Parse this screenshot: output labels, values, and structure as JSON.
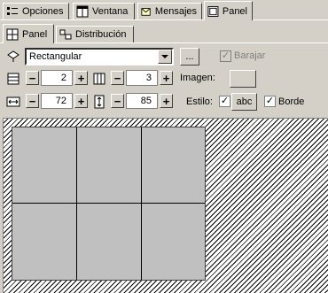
{
  "tabs": [
    {
      "label": "Opciones"
    },
    {
      "label": "Ventana"
    },
    {
      "label": "Mensajes"
    },
    {
      "label": "Panel"
    }
  ],
  "subtabs": [
    {
      "label": "Panel"
    },
    {
      "label": "Distribución"
    }
  ],
  "shape_select": {
    "value": "Rectangular"
  },
  "ellipsis_label": "...",
  "barajar": {
    "label": "Barajar",
    "checked": true
  },
  "rows": {
    "value": "2"
  },
  "cols": {
    "value": "3"
  },
  "imagen": {
    "label": "Imagen:"
  },
  "width": {
    "value": "72"
  },
  "height": {
    "value": "85"
  },
  "estilo": {
    "label": "Estilo:",
    "sample": "abc"
  },
  "borde": {
    "label": "Borde",
    "checked": true
  },
  "icons": [
    "layout-icon",
    "window-icon",
    "messages-icon",
    "panel-icon",
    "grid-icon",
    "distribution-icon",
    "shape-icon",
    "rows-icon",
    "cols-icon",
    "width-icon",
    "height-icon"
  ]
}
